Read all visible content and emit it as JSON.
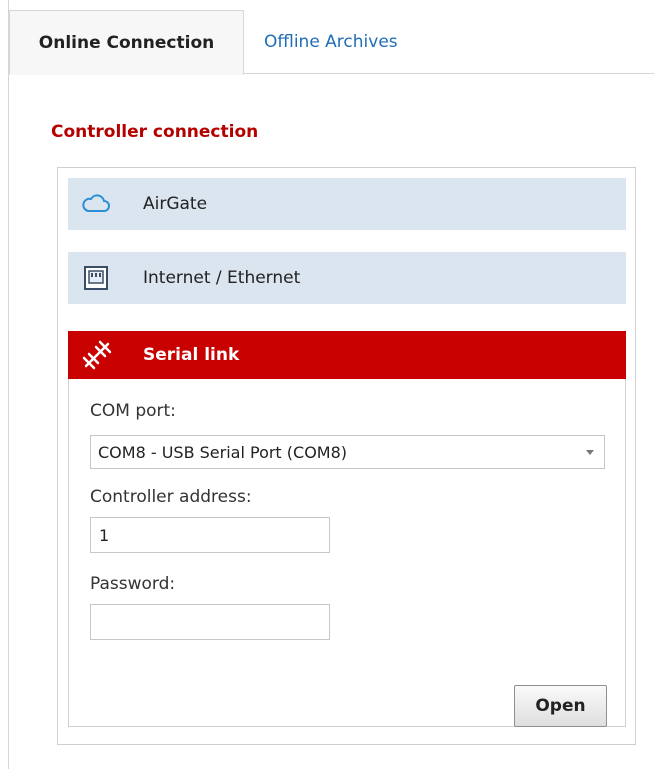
{
  "tabs": [
    {
      "label": "Online Connection",
      "active": true
    },
    {
      "label": "Offline Archives",
      "active": false
    }
  ],
  "section_title": "Controller connection",
  "connections": {
    "airgate": {
      "label": "AirGate",
      "icon": "cloud-icon"
    },
    "internet": {
      "label": "Internet / Ethernet",
      "icon": "ethernet-port-icon"
    },
    "serial": {
      "label": "Serial link",
      "icon": "serial-cable-icon",
      "expanded": true
    }
  },
  "serial_form": {
    "com_port_label": "COM port:",
    "com_port_value": "COM8 - USB Serial Port (COM8)",
    "address_label": "Controller address:",
    "address_value": "1",
    "password_label": "Password:",
    "password_value": "",
    "open_label": "Open"
  },
  "colors": {
    "accent_red": "#c90000",
    "title_red": "#b50000",
    "link_blue": "#1f6db5",
    "row_bg": "#dbe5ef"
  }
}
